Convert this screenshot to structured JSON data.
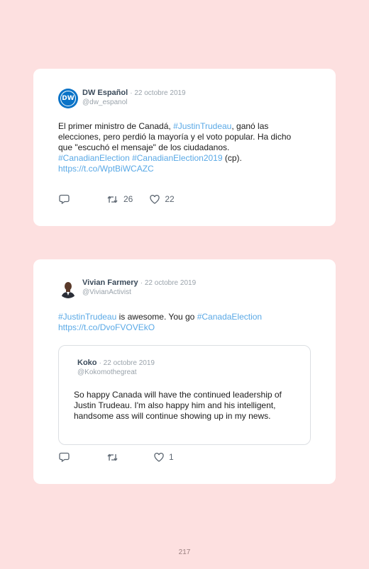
{
  "tweets": [
    {
      "name": "DW Español",
      "date": "· 22 octobre 2019",
      "handle": "@dw_espanol",
      "avatar_text": "DW",
      "text_parts": {
        "a": "El primer ministro de Canadá, ",
        "b": "#JustinTrudeau",
        "c": ", ganó las elecciones, pero perdió la mayoría y el voto popular. Ha dicho que \"escuchó el mensaje\" de los ciudadanos. ",
        "d": "#CanadianElection",
        "e": " ",
        "f": "#CanadianElection2019",
        "g": " (cp). ",
        "h": "https://t.co/WptBiWCAZC"
      },
      "retweets": "26",
      "likes": "22"
    },
    {
      "name": "Vivian Farmery",
      "date": "· 22 octobre 2019",
      "handle": "@VivianActivist",
      "text_parts": {
        "a": "#JustinTrudeau",
        "b": " is awesome. You go ",
        "c": "#CanadaElection",
        "d": "https://t.co/DvoFVOVEkO"
      },
      "quote": {
        "name": "Koko",
        "date": "· 22 octobre 2019",
        "handle": "@Kokomothegreat",
        "text": "So happy Canada will have the continued leadership of Justin Trudeau. I'm also happy him and his intelligent, handsome ass will continue showing up in my news."
      },
      "retweets": "",
      "likes": "1"
    }
  ],
  "page_number": "217",
  "colors": {
    "background": "#fde0e0",
    "link": "#5aa9e6",
    "dw_blue": "#0a73c7"
  },
  "icons": [
    "reply-icon",
    "retweet-icon",
    "like-icon"
  ]
}
